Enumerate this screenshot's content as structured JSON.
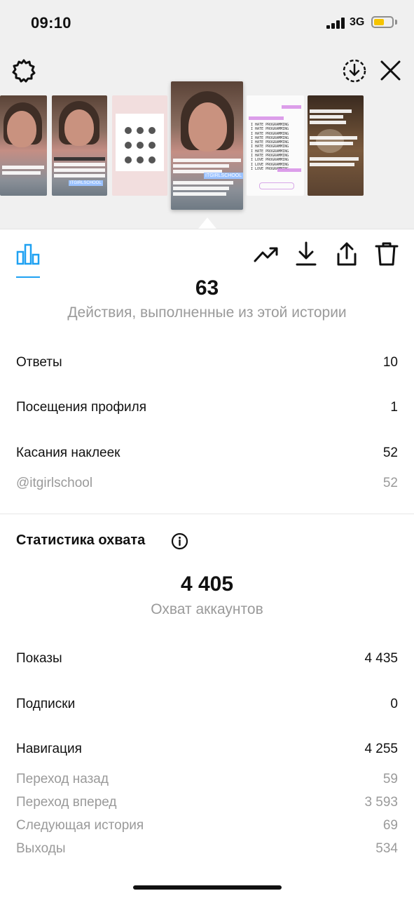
{
  "status_bar": {
    "time": "09:10",
    "network": "3G"
  },
  "toolbar": {
    "settings_icon": "gear-icon",
    "save_icon": "download-circle-icon",
    "close_icon": "close-icon",
    "tabs": [
      "bar-chart-icon",
      "trending-up-icon",
      "download-icon",
      "share-icon",
      "trash-icon"
    ]
  },
  "actions": {
    "total": "63",
    "caption": "Действия, выполненные из этой истории",
    "rows": [
      {
        "label": "Ответы",
        "value": "10"
      },
      {
        "label": "Посещения профиля",
        "value": "1"
      },
      {
        "label": "Касания наклеек",
        "value": "52"
      }
    ],
    "sub_rows": [
      {
        "label": "@itgirlschool",
        "value": "52"
      }
    ]
  },
  "reach": {
    "title": "Статистика охвата",
    "total": "4 405",
    "caption": "Охват аккаунтов",
    "rows": [
      {
        "label": "Показы",
        "value": "4 435"
      },
      {
        "label": "Подписки",
        "value": "0"
      },
      {
        "label": "Навигация",
        "value": "4 255"
      }
    ],
    "sub_rows": [
      {
        "label": "Переход назад",
        "value": "59"
      },
      {
        "label": "Переход вперед",
        "value": "3 593"
      },
      {
        "label": "Следующая история",
        "value": "69"
      },
      {
        "label": "Выходы",
        "value": "534"
      }
    ]
  },
  "thumbnails": {
    "sticker_text": "ITGIRLSCHOOL",
    "programming_line": "I HATE PROGRAMMING",
    "final_line": "I LOVE PROGRAMMING"
  }
}
